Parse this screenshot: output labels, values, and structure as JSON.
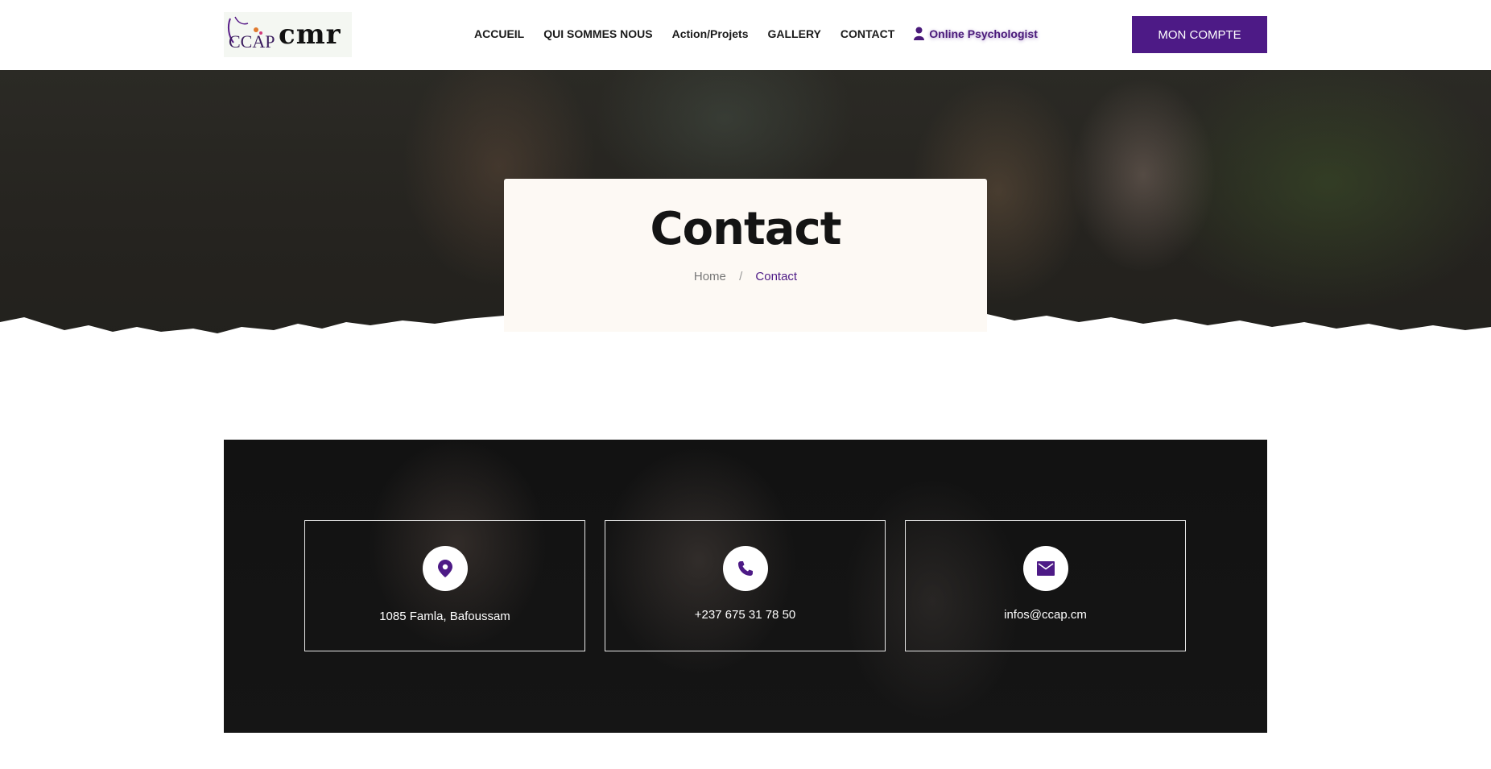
{
  "header": {
    "logo": {
      "mark_text": "CCAP",
      "name": "cmr"
    },
    "nav": [
      {
        "label": "ACCUEIL"
      },
      {
        "label": "QUI SOMMES NOUS"
      },
      {
        "label": "Action/Projets"
      },
      {
        "label": "GALLERY"
      },
      {
        "label": "CONTACT"
      },
      {
        "label": "Online Psychologist",
        "icon": "user-icon"
      }
    ],
    "account_button": "MON COMPTE"
  },
  "hero": {
    "title": "Contact",
    "breadcrumb": {
      "home": "Home",
      "separator": "/",
      "current": "Contact"
    }
  },
  "contact_cards": [
    {
      "icon": "location-pin-icon",
      "text": "1085 Famla, Bafoussam"
    },
    {
      "icon": "phone-icon",
      "text": "+237 675 31 78 50"
    },
    {
      "icon": "mail-icon",
      "text": "infos@ccap.cm"
    }
  ],
  "colors": {
    "accent": "#4d1a86",
    "dark": "#141414",
    "card_bg": "#fdf9f4"
  }
}
